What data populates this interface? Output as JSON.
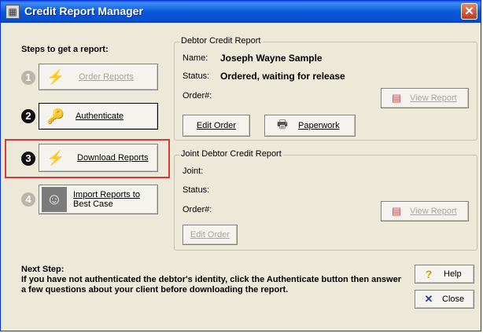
{
  "window": {
    "title": "Credit Report Manager",
    "close_glyph": "✕"
  },
  "steps": {
    "title": "Steps to get a report:",
    "items": [
      {
        "number": "1",
        "label": "Order Reports",
        "enabled": false,
        "icon": "lightning-icon"
      },
      {
        "number": "2",
        "label": "Authenticate",
        "enabled": true,
        "icon": "key-icon"
      },
      {
        "number": "3",
        "label": "Download Reports",
        "enabled": true,
        "icon": "lightning-icon"
      },
      {
        "number": "4",
        "label": "Import Reports to Best Case",
        "label_line1": "Import Reports to",
        "label_line2": "Best Case",
        "enabled": false,
        "icon": "face-icon"
      }
    ]
  },
  "debtor": {
    "group_title": "Debtor Credit Report",
    "name_label": "Name:",
    "name_value": "Joseph Wayne Sample",
    "status_label": "Status:",
    "status_value": "Ordered, waiting for release",
    "order_label": "Order#:",
    "order_value": "",
    "view_report": "View Report",
    "edit_order": "Edit Order",
    "paperwork": "Paperwork"
  },
  "joint": {
    "group_title": "Joint Debtor Credit Report",
    "joint_label": "Joint:",
    "status_label": "Status:",
    "order_label": "Order#:",
    "view_report": "View Report",
    "edit_order": "Edit Order"
  },
  "next_step": {
    "heading": "Next Step:",
    "text": "If you have not authenticated the debtor's identity, click the Authenticate button then answer a few questions about your client before downloading the report."
  },
  "actions": {
    "help": "Help",
    "close": "Close"
  },
  "colors": {
    "titlebar": "#0a59d8",
    "highlight": "#d9383a",
    "face": "#ece9d8"
  }
}
